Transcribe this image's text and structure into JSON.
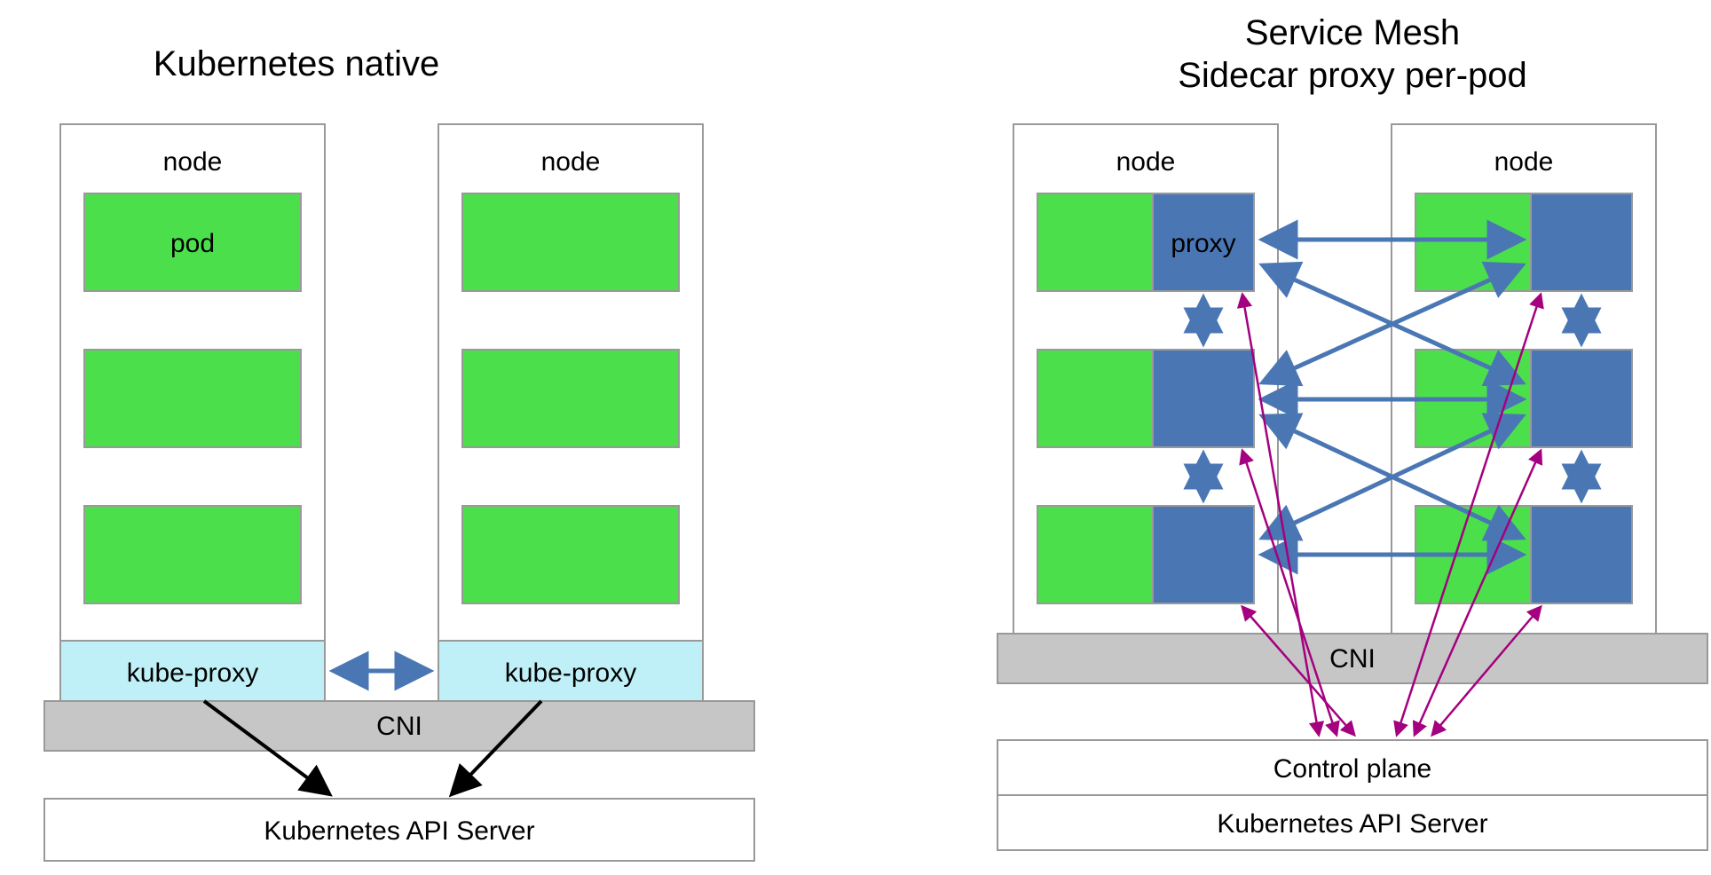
{
  "left": {
    "title": "Kubernetes native",
    "node_label": "node",
    "pod_label": "pod",
    "kube_proxy_label": "kube-proxy",
    "cni_label": "CNI",
    "api_label": "Kubernetes API Server"
  },
  "right": {
    "title1": "Service Mesh",
    "title2": "Sidecar proxy per-pod",
    "node_label": "node",
    "proxy_label": "proxy",
    "cni_label": "CNI",
    "control_plane_label": "Control plane",
    "api_label": "Kubernetes API Server"
  },
  "colors": {
    "pod": "#4be04b",
    "proxy": "#4a77b4",
    "kubeproxy": "#bff0f8",
    "cni": "#c6c6c6",
    "stroke": "#999999",
    "arrow_blue": "#4a77b4",
    "arrow_black": "#000000",
    "arrow_purple": "#a4007f"
  }
}
